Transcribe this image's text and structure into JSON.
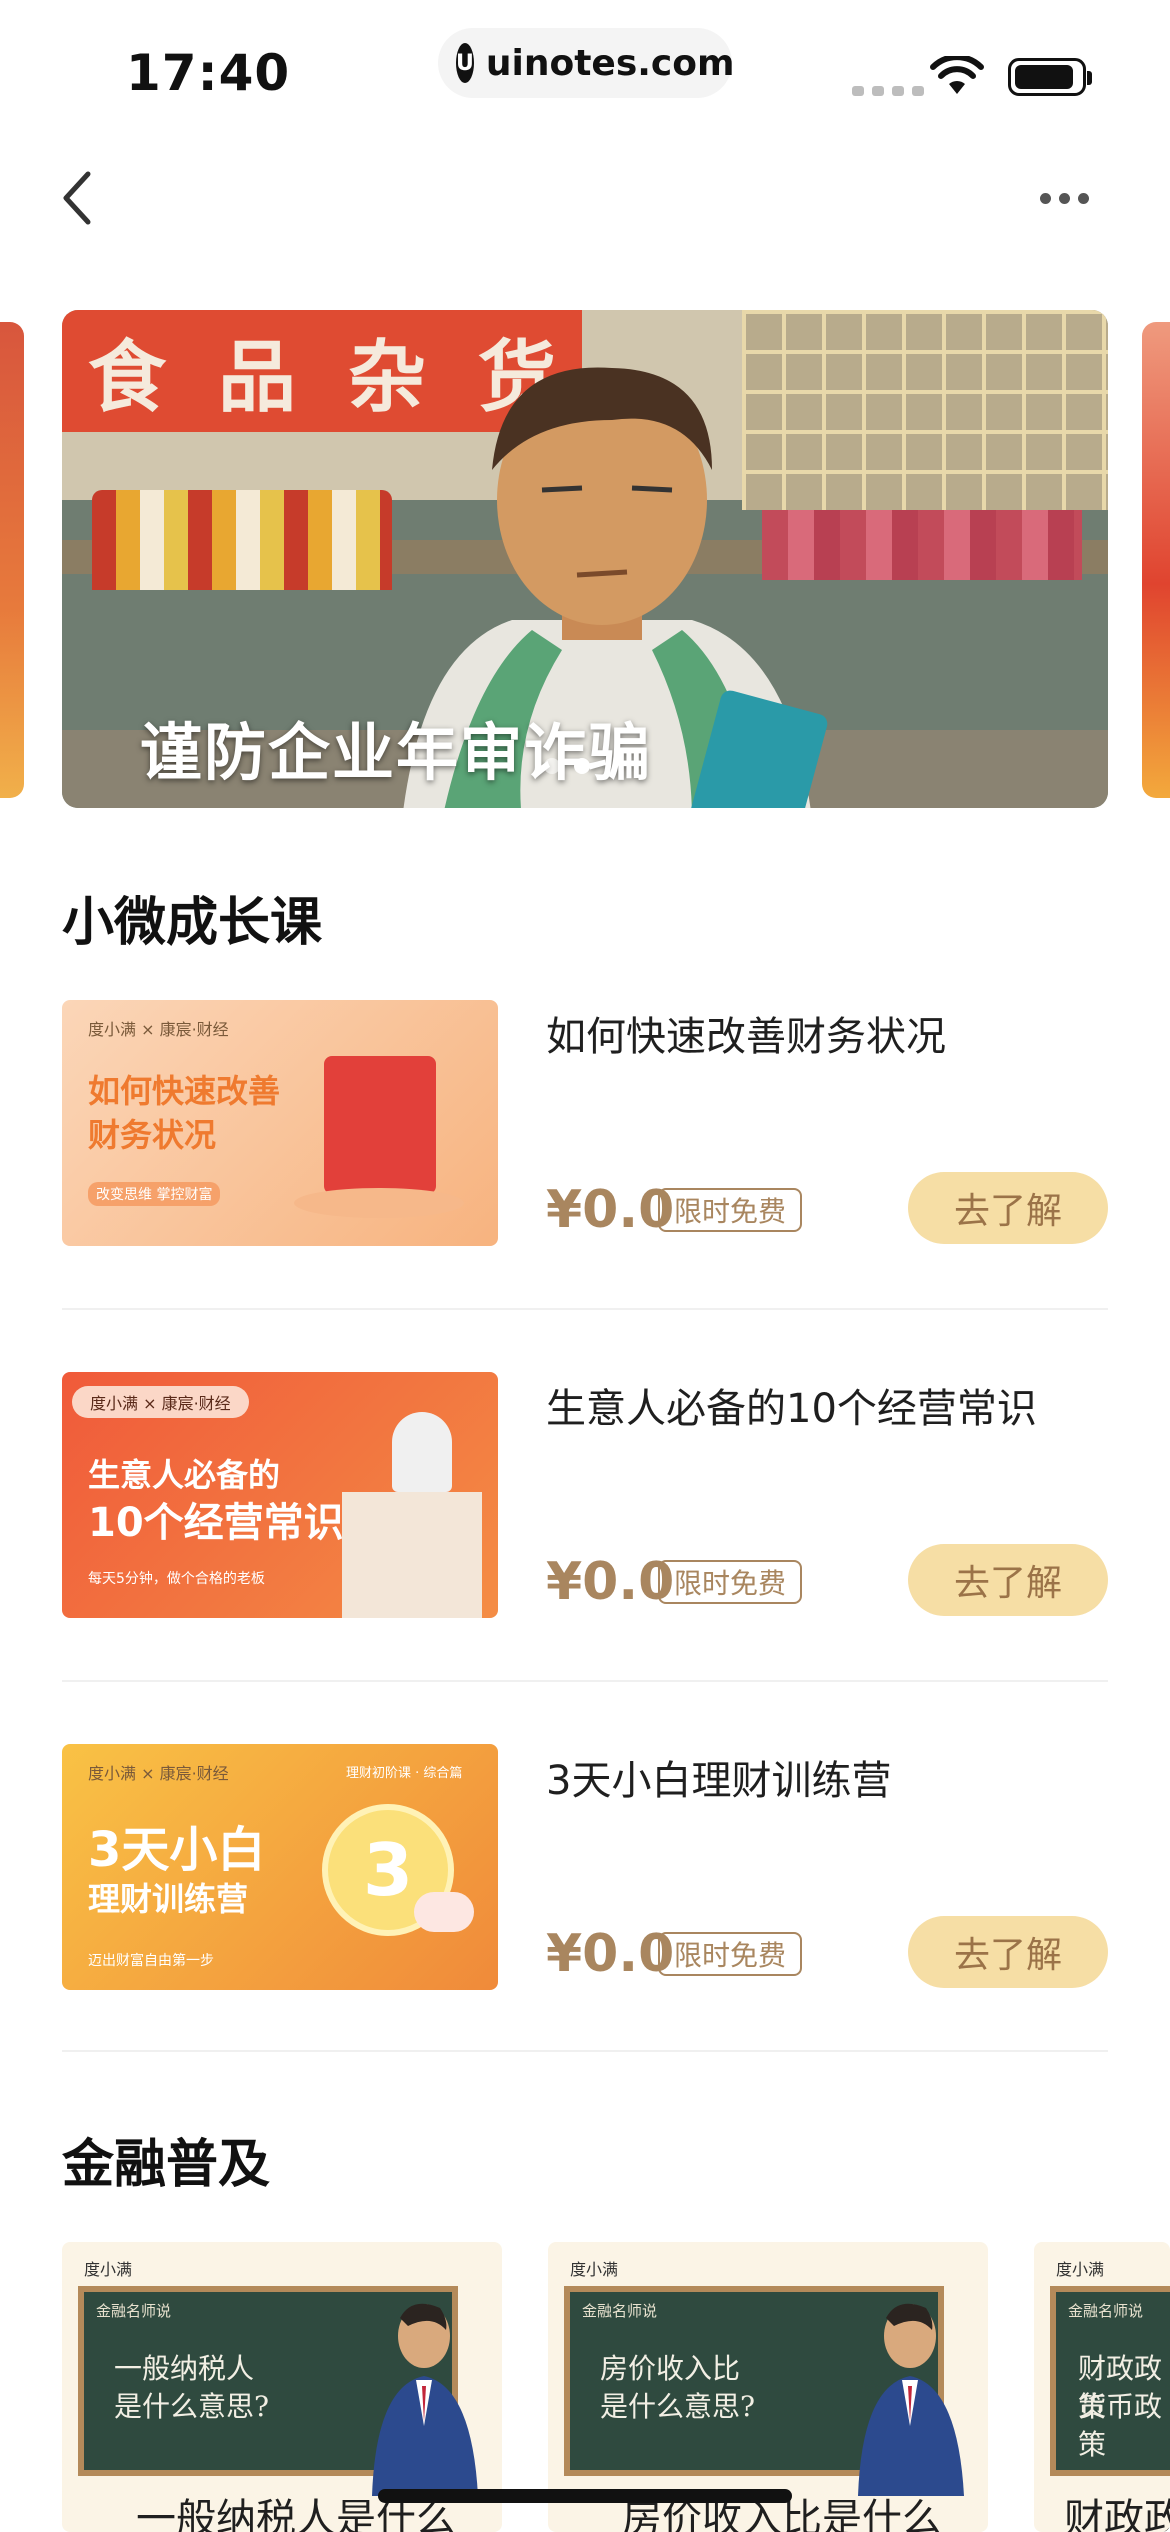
{
  "status_bar": {
    "time": "17:40",
    "url": "uinotes.com",
    "logo_glyph": "U"
  },
  "nav": {
    "back_icon": "chevron-left-icon",
    "more_icon": "more-dots-icon"
  },
  "banner": {
    "title": "谨防企业年审诈骗",
    "sign_chars": [
      "食",
      "品",
      "杂",
      "货"
    ],
    "dots": 2,
    "active_dot": 1
  },
  "growth_section": {
    "title": "小微成长课",
    "courses": [
      {
        "name": "如何快速改善财务状况",
        "price": "¥0.0",
        "tag": "限时免费",
        "button": "去了解",
        "thumb": {
          "brand": "度小满 × 康宸·财经",
          "line1": "如何快速改善",
          "line2": "财务状况",
          "sub": "改变思维 掌控财富"
        }
      },
      {
        "name": "生意人必备的10个经营常识",
        "price": "¥0.0",
        "tag": "限时免费",
        "button": "去了解",
        "thumb": {
          "brand": "度小满 × 康宸·财经",
          "line1": "生意人必备的",
          "line2": "10个经营常识",
          "sub": "每天5分钟，做个合格的老板"
        }
      },
      {
        "name": "3天小白理财训练营",
        "price": "¥0.0",
        "tag": "限时免费",
        "button": "去了解",
        "thumb": {
          "brand": "度小满 × 康宸·财经",
          "badge": "理财初阶课 · 综合篇",
          "line1": "3天小白",
          "line2": "理财训练营",
          "sub": "迈出财富自由第一步"
        }
      }
    ]
  },
  "finance_section": {
    "title": "金融普及",
    "cards": [
      {
        "brand": "度小满",
        "board_top": "金融名师说",
        "board_text": [
          "一般纳税人",
          "是什么意思?"
        ],
        "caption": "一般纳税人是什么"
      },
      {
        "brand": "度小满",
        "board_top": "金融名师说",
        "board_text": [
          "房价收入比",
          "是什么意思?"
        ],
        "caption": "房价收入比是什么"
      },
      {
        "brand": "度小满",
        "board_top": "金融名师说",
        "board_text": [
          "财政政策",
          "货币政策"
        ],
        "caption": "财政政策"
      }
    ]
  },
  "colors": {
    "accent": "#a9865f",
    "button_bg": "#f6dea5",
    "button_text": "#9b7348"
  }
}
